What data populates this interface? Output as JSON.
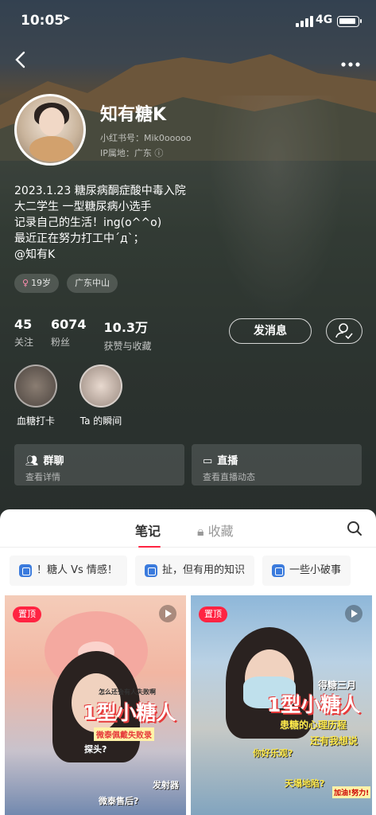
{
  "status_bar": {
    "time": "10:05",
    "location_icon": "location-arrow-icon",
    "network": "4G"
  },
  "nav": {
    "back_icon": "chevron-left-icon",
    "more_icon": "more-dots-icon"
  },
  "profile": {
    "name": "知有糖K",
    "red_id": "小红书号：Mik0ooooo",
    "ip": "IP属地：广东",
    "bio_lines": [
      "2023.1.23 糖尿病酮症酸中毒入院",
      "大二学生 一型糖尿病小选手",
      "记录自己的生活！ing(o^^o)",
      "最近正在努力打工中´д`；",
      "@知有K"
    ],
    "tags": {
      "gender": "♀",
      "age": "19岁",
      "region": "广东中山"
    },
    "stats": [
      {
        "value": "45",
        "label": "关注"
      },
      {
        "value": "6074",
        "label": "粉丝"
      },
      {
        "value": "10.3万",
        "label": "获赞与收藏"
      }
    ],
    "message_button": "发消息"
  },
  "highlights": [
    {
      "label": "血糖打卡"
    },
    {
      "label": "Ta 的瞬间"
    }
  ],
  "cards": [
    {
      "title": "群聊",
      "subtitle": "查看详情",
      "icon": "group-icon"
    },
    {
      "title": "直播",
      "subtitle": "查看直播动态",
      "icon": "live-camera-icon"
    }
  ],
  "tabs": {
    "notes": "笔记",
    "favorites": "收藏",
    "favorites_icon": "lock-icon",
    "search_icon": "search-icon"
  },
  "chips": [
    "！糖人 Vs 情感！",
    "扯，但有用的知识",
    "一些小破事"
  ],
  "notes": [
    {
      "pin": "置顶",
      "headline": "1型小糖人",
      "top_text": "怎么还会有人失败啊",
      "sub_text": "微泰佩戴失败录",
      "stickers": [
        "探头?",
        "发射器",
        "微泰售后?"
      ]
    },
    {
      "pin": "置顶",
      "headline": "1型小糖人",
      "top_text": "得糖三月",
      "sub_text": "患糖的心理历程",
      "sub_text2": "还有我想说",
      "stickers": [
        "你好乐观?",
        "天塌地陷?",
        "加油!努力!"
      ]
    }
  ],
  "colors": {
    "accent": "#ff2442",
    "chip_icon": "#3b7bdd"
  }
}
